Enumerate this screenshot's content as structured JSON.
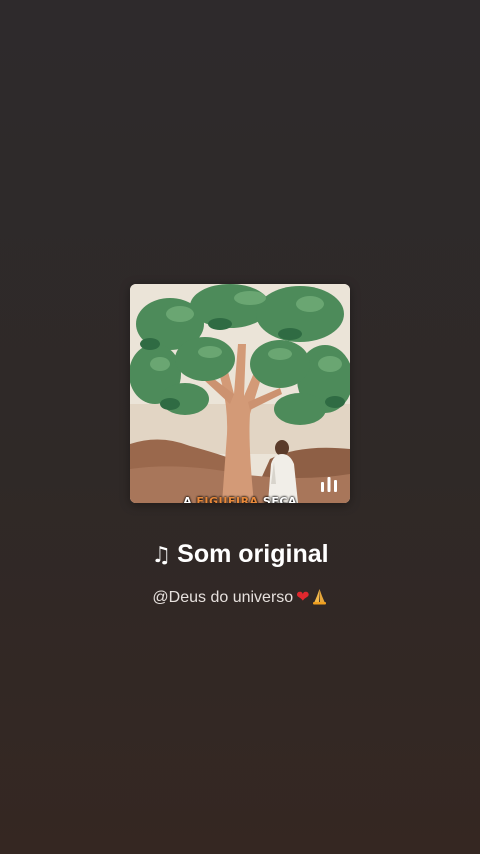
{
  "audio": {
    "cover": {
      "caption_parts": [
        "A ",
        "FIGUEIRA",
        " SECA"
      ],
      "cover_colors": {
        "sky": "#e9e2d6",
        "trunk": "#d49a78",
        "leaves": "#4f8f5c",
        "ground": "#9b6b50",
        "robe": "#f2f0ea"
      },
      "playing_icon": "equalizer-bars-icon"
    },
    "title": {
      "icon": "music-note-icon",
      "note_glyph": "♫",
      "text": "Som original"
    },
    "author": {
      "handle": "@Deus do universo",
      "heart_glyph": "❤",
      "heart_color": "#e0282e",
      "praying_icon": "praying-hands-icon"
    }
  }
}
